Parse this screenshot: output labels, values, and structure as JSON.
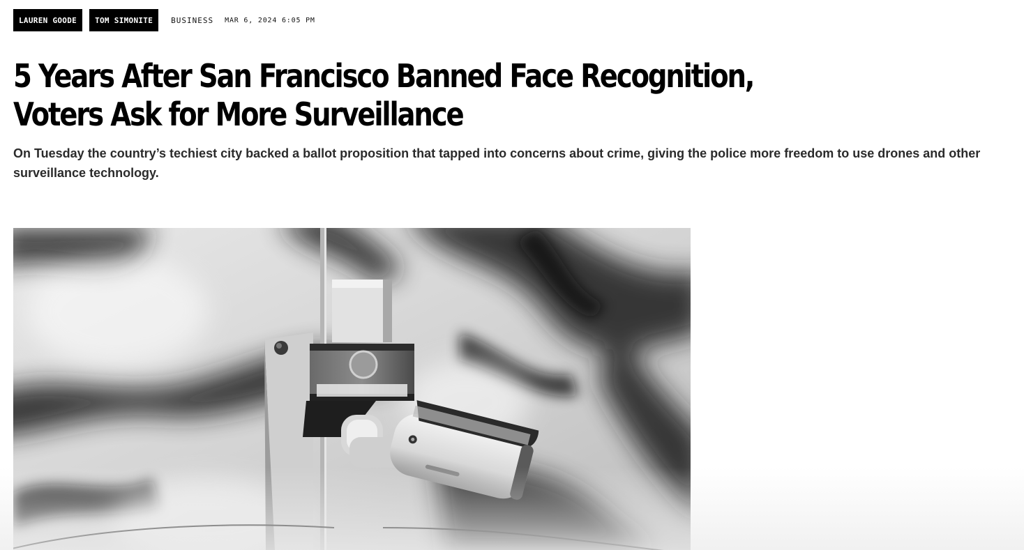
{
  "article": {
    "authors": [
      "LAUREN GOODE",
      "TOM SIMONITE"
    ],
    "section": "BUSINESS",
    "date": "MAR 6, 2024 6:05 PM",
    "headline": "5 Years After San Francisco Banned Face Recognition, Voters Ask for More Surveillance",
    "dek": "On Tuesday the country’s techiest city backed a ballot proposition that tapped into concerns about crime, giving the police more freedom to use drones and other surveillance technology."
  },
  "lead_image": {
    "subject": "surveillance-camera-photo"
  }
}
